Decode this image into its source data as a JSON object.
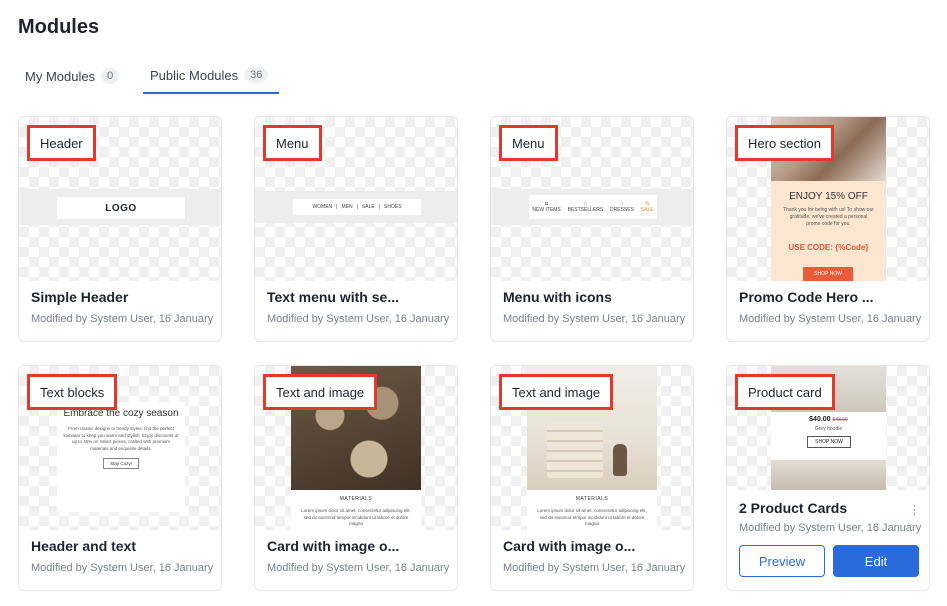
{
  "page": {
    "title": "Modules"
  },
  "tabs": [
    {
      "label": "My Modules",
      "count": "0",
      "active": false
    },
    {
      "label": "Public Modules",
      "count": "36",
      "active": true
    }
  ],
  "cards": [
    {
      "tag": "Header",
      "title": "Simple Header",
      "meta": "Modified by System User, 16 January",
      "preview": {
        "logo": "LOGO"
      }
    },
    {
      "tag": "Menu",
      "title": "Text menu with se...",
      "meta": "Modified by System User, 16 January",
      "preview": {
        "items": [
          "WOMEN",
          "MEN",
          "SALE",
          "SHOES"
        ]
      }
    },
    {
      "tag": "Menu",
      "title": "Menu with icons",
      "meta": "Modified by System User, 16 January",
      "preview": {
        "items": [
          "NEW ITEMS",
          "BESTSELLERS",
          "DRESSES",
          "SALE"
        ]
      }
    },
    {
      "tag": "Hero section",
      "title": "Promo Code Hero ...",
      "meta": "Modified by System User, 16 January",
      "preview": {
        "heading": "ENJOY 15% OFF",
        "body": "Thank you for being with us! To show our gratitude, we've created a personal promo code for you.",
        "code": "USE CODE: {%Code}",
        "button": "SHOP NOW"
      }
    },
    {
      "tag": "Text blocks",
      "title": "Header and text",
      "meta": "Modified by System User, 16 January",
      "preview": {
        "heading": "Embrace the cozy season",
        "body": "From classic designs to trendy styles, find the perfect knitwear to keep you warm and stylish. Enjoy discounts of up to 45% on select pieces, crafted with premium materials and exquisite details.",
        "button": "Stay Cozy!"
      }
    },
    {
      "tag": "Text and image",
      "title": "Card with image o...",
      "meta": "Modified by System User, 16 January",
      "preview": {
        "caption": "MATERIALS",
        "body": "Lorem ipsum dolor sit amet, consectetur adipiscing elit, sed do eiusmod tempor incididunt ut labore et dolore magna"
      }
    },
    {
      "tag": "Text and image",
      "title": "Card with image o...",
      "meta": "Modified by System User, 16 January",
      "preview": {
        "caption": "MATERIALS",
        "body": "Lorem ipsum dolor sit amet, consectetur adipiscing elit, sed do eiusmod tempor incididunt ut labore et dolore magna"
      }
    },
    {
      "tag": "Product card",
      "title": "2 Product Cards",
      "meta": "Modified by System User, 16 January",
      "preview": {
        "price": "$40.00",
        "old_price": "$48.00",
        "name": "Grey hoodie",
        "button": "SHOP NOW"
      },
      "actions": {
        "preview": "Preview",
        "edit": "Edit"
      },
      "more": "⋮"
    }
  ],
  "colors": {
    "accent": "#2a6bdc",
    "tag_border": "#e03a2a"
  }
}
